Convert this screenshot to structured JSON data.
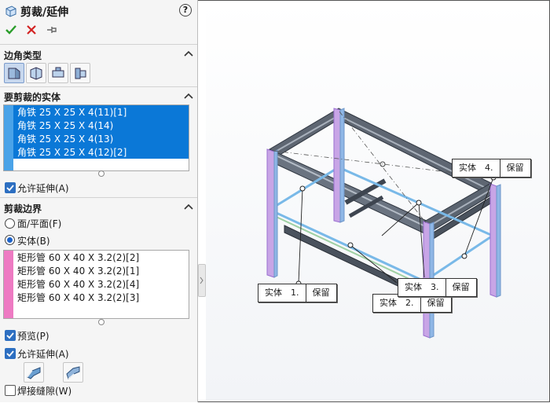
{
  "header": {
    "title": "剪裁/延伸",
    "help": "?"
  },
  "corner": {
    "label": "边角类型"
  },
  "bodies_to_trim": {
    "label": "要剪裁的实体",
    "items": [
      "角铁 25 X 25 X 4(11)[1]",
      "角铁 25 X 25 X 4(14)",
      "角铁 25 X 25 X 4(13)",
      "角铁 25 X 25 X 4(12)[2]"
    ],
    "allow_extend": "允许延伸(A)"
  },
  "boundary": {
    "label": "剪裁边界",
    "option_face": "面/平面(F)",
    "option_body": "实体(B)",
    "items": [
      "矩形管 60 X 40 X 3.2(2)[2]",
      "矩形管 60 X 40 X 3.2(2)[1]",
      "矩形管 60 X 40 X 3.2(2)[4]",
      "矩形管 60 X 40 X 3.2(2)[3]"
    ],
    "preview": "预览(P)",
    "allow_extend": "允许延伸(A)",
    "weld_gap": "焊接缝隙(W)"
  },
  "colors": {
    "selection": "#0b78d7",
    "boundary_bar": "#ee7bc3",
    "trim_bar": "#4aa3e8"
  },
  "callouts": [
    {
      "body": "实体　1.",
      "action": "保留"
    },
    {
      "body": "实体　2.",
      "action": "保留"
    },
    {
      "body": "实体　3.",
      "action": "保留"
    },
    {
      "body": "实体　4.",
      "action": "保留"
    }
  ]
}
